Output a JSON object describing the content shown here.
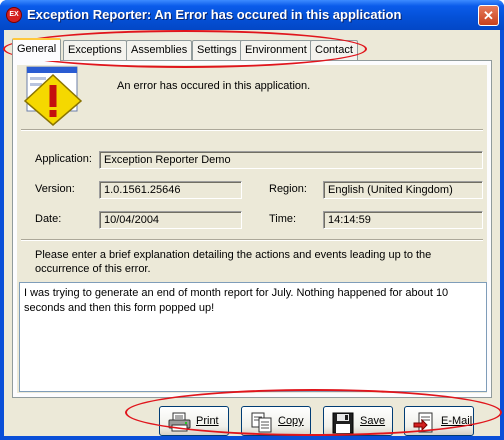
{
  "window": {
    "title": "Exception Reporter: An Error has occured in this application",
    "app_icon_text": "EX",
    "close_glyph": "✕"
  },
  "tabs": [
    {
      "label": "General",
      "active": true
    },
    {
      "label": "Exceptions",
      "active": false
    },
    {
      "label": "Assemblies",
      "active": false
    },
    {
      "label": "Settings",
      "active": false
    },
    {
      "label": "Environment",
      "active": false
    },
    {
      "label": "Contact",
      "active": false
    }
  ],
  "general": {
    "error_message": "An error has occured in this application.",
    "application_label": "Application:",
    "application_value": "Exception Reporter Demo",
    "version_label": "Version:",
    "version_value": "1.0.1561.25646",
    "region_label": "Region:",
    "region_value": "English (United Kingdom)",
    "date_label": "Date:",
    "date_value": "10/04/2004",
    "time_label": "Time:",
    "time_value": "14:14:59",
    "explanation_prompt": "Please enter a brief explanation detailing the actions and events leading up to the occurrence of this error.",
    "explanation_text": "I was trying to generate an end of month report for July. Nothing happened for about 10 seconds and then this form popped up!"
  },
  "buttons": {
    "print": "Print",
    "copy": "Copy",
    "save": "Save",
    "email": "E-Mail"
  },
  "icons": [
    "warning-icon",
    "printer-icon",
    "copy-icon",
    "floppy-disk-icon",
    "email-icon"
  ],
  "colors": {
    "titlebar": "#0450d6",
    "annotation": "#e0151c",
    "warning": "#f5d800"
  }
}
